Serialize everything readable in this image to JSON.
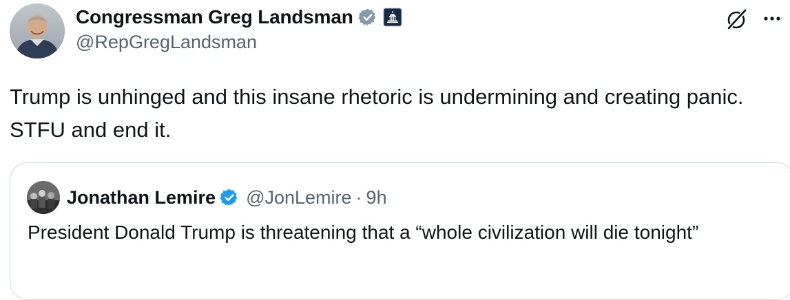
{
  "author": {
    "display_name": "Congressman Greg Landsman",
    "handle": "@RepGregLandsman",
    "verified_badge": "gray-verified-icon",
    "affiliation_badge": "us-capitol-icon"
  },
  "header_actions": {
    "grok_icon": "grok-slash-icon",
    "more_icon": "more-horizontal-icon"
  },
  "tweet": {
    "text": "Trump is unhinged and this insane rhetoric is undermining and creating panic. STFU and end it."
  },
  "quote": {
    "display_name": "Jonathan Lemire",
    "handle": "@JonLemire",
    "separator": "·",
    "time": "9h",
    "text": "President Donald Trump is threatening that a “whole civilization will die tonight”",
    "verified_badge": "blue-verified-icon"
  },
  "colors": {
    "text_primary": "#0f1419",
    "text_secondary": "#536471",
    "verified_blue": "#1d9bf0",
    "verified_gray": "#829aab",
    "border": "#cfd9de"
  }
}
